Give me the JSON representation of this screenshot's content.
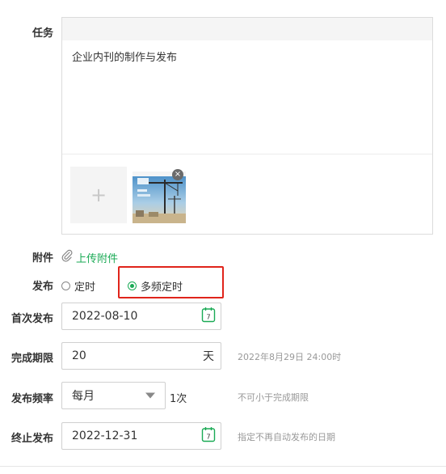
{
  "task": {
    "label": "任务",
    "content": "企业内刊的制作与发布",
    "add_symbol": "+",
    "remove_symbol": "×"
  },
  "attachment": {
    "label": "附件",
    "upload_label": "上传附件"
  },
  "publish": {
    "label": "发布",
    "options": [
      "定时",
      "多频定时"
    ],
    "selected": "多频定时"
  },
  "first_publish": {
    "label": "首次发布",
    "value": "2022-08-10"
  },
  "deadline": {
    "label": "完成期限",
    "value": "20",
    "unit": "天",
    "hint": "2022年8月29日 24:00时"
  },
  "frequency": {
    "label": "发布频率",
    "value": "每月",
    "times": "1次",
    "hint": "不可小于完成期限"
  },
  "end_publish": {
    "label": "终止发布",
    "value": "2022-12-31",
    "hint": "指定不再自动发布的日期"
  },
  "calendar_day": "7",
  "colors": {
    "accent": "#1aaa55",
    "highlight": "#e0241b"
  }
}
